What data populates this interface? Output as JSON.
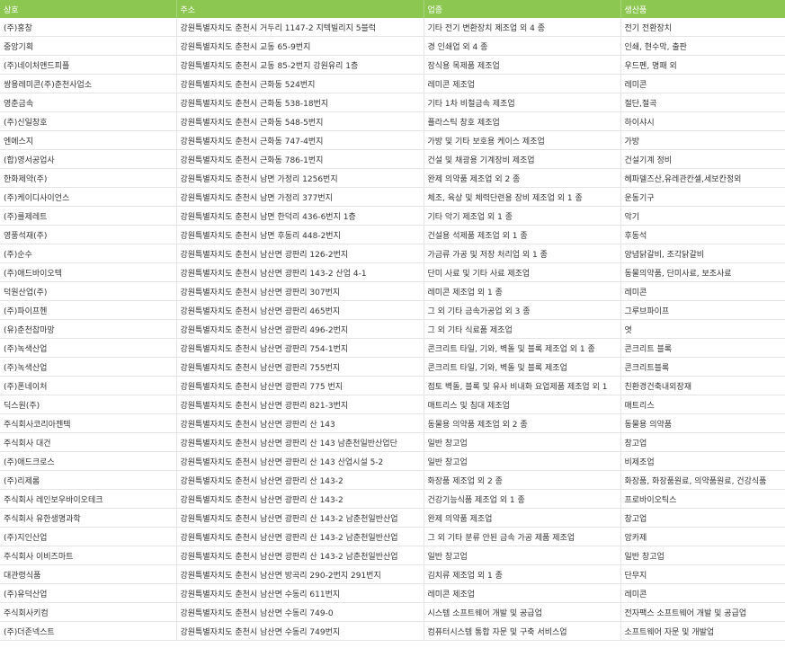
{
  "table": {
    "columns": [
      "상호",
      "주소",
      "업종",
      "생산품"
    ],
    "rows": [
      [
        "(주)홍창",
        "강원특별자치도 춘천시 거두리 1147-2 지텍빌리지 5블럭",
        "기타 전기 변환장치 제조업 외 4 종",
        "전기 전환장치"
      ],
      [
        "중앙기획",
        "강원특별자치도 춘천시 교동 65-9번지",
        "경 인쇄업 외 4 종",
        "인쇄, 현수막, 출판"
      ],
      [
        "(주)네이처앤드피플",
        "강원특별자치도 춘천시 교동 85-2번지 강원유리 1층",
        "장식용 목제품 제조업",
        "우드펜, 명패 외"
      ],
      [
        "쌍용레미콘(주)춘천사업소",
        "강원특별자치도 춘천시 근화동 524번지",
        "레미콘 제조업",
        "레미콘"
      ],
      [
        "영춘금속",
        "강원특별자치도 춘천시 근화동 538-18번지",
        "기타 1차 비철금속 제조업",
        "절단,절곡"
      ],
      [
        "(주)신일창호",
        "강원특별자치도 춘천시 근화동 548-5번지",
        "플라스틱 창호 제조업",
        "하이샤시"
      ],
      [
        "엔에스지",
        "강원특별자치도 춘천시 근화동 747-4번지",
        "가방 및 기타 보호용 케이스 제조업",
        "가방"
      ],
      [
        "(합)영서공업사",
        "강원특별자치도 춘천시 근화동 786-1번지",
        "건설 및 채광용 기계장비 제조업",
        "건설기계 정비"
      ],
      [
        "한화제약(주)",
        "강원특별자치도 춘천시 남면 가정리 1256번지",
        "완제 의약품 제조업 외 2 종",
        "헤파델즈산,유레관칸셀,세보칸정외"
      ],
      [
        "(주)케이디사이언스",
        "강원특별자치도 춘천시 남면 가정리 377번지",
        "체조, 육상 및 체력단련용 장비 제조업 외 1 종",
        "운동기구"
      ],
      [
        "(주)를제레트",
        "강원특별자치도 춘천시 남면 한덕리 436-6번지 1층",
        "기타 악기 제조업 외 1 종",
        "악기"
      ],
      [
        "영풍석재(주)",
        "강원특별자치도 춘천시 남면 후동리 448-2번지",
        "건설용 석제품 제조업 외 1 종",
        "후동석"
      ],
      [
        "(주)순수",
        "강원특별자치도 춘천시 남산면 광판리 126-2번지",
        "가금류 가공 및 저장 처리업 외 1 종",
        "양념닭갈비, 조각닭갈비"
      ],
      [
        "(주)애드바이오텍",
        "강원특별자치도 춘천시 남산면 광판리 143-2 산업 4-1",
        "단미 사료 및 기타 사료 제조업",
        "동물의약품, 단미사료, 보조사료"
      ],
      [
        "덕원산업(주)",
        "강원특별자치도 춘천시 남산면 광판리 307번지",
        "레미콘 제조업 외 1 종",
        "레미콘"
      ],
      [
        "(주)파이프헨",
        "강원특별자치도 춘천시 남산면 광판리 465번지",
        "그 외 기타 금속가공업 외 3 종",
        "그루브파이프"
      ],
      [
        "(유)춘천찹마망",
        "강원특별자치도 춘천시 남산면 광판리 496-2번지",
        "그 외 기타 식료품 제조업",
        "엿"
      ],
      [
        "(주)녹색산업",
        "강원특별자치도 춘천시 남산면 광판리 754-1번지",
        "콘크리트 타일, 기와, 벽돌 및 블록 제조업 외 1 종",
        "콘크리트 블록"
      ],
      [
        "(주)녹색산업",
        "강원특별자치도 춘천시 남산면 광판리 755번지",
        "콘크리트 타일, 기와, 벽돌 및 블록 제조업",
        "콘크리트블록"
      ],
      [
        "(주)폰네이처",
        "강원특별자치도 춘천시 남산면 광판리 775 번지",
        "점토 벽돌, 블록 및 유사 비내화 요업제품 제조업 외 1",
        "친환경건축내외장재"
      ],
      [
        "딕스원(주)",
        "강원특별자치도 춘천시 남산면 광판리 821-3번지",
        "매트리스 및 침대 제조업",
        "매트리스"
      ],
      [
        "주식회사코리아젠텍",
        "강원특별자치도 춘천시 남산면 광판리 산 143",
        "동물용 의약품 제조업 외 2 종",
        "동물용 의약품"
      ],
      [
        "주식회사 대건",
        "강원특별자치도 춘천시 남산면 광판리 산 143 남춘천일반산업단",
        "일반 창고업",
        "창고업"
      ],
      [
        "(주)애드크로스",
        "강원특별자치도 춘천시 남산면 광판리 산 143 산업시설 5-2",
        "일반 창고업",
        "비제조업"
      ],
      [
        "(주)리제롬",
        "강원특별자치도 춘천시 남산면 광판리 산 143-2",
        "화장품 제조업 외 2 종",
        "화장품, 화장품원료, 의약품원료, 건강식품"
      ],
      [
        "주식회사 레인보우바이오테크",
        "강원특별자치도 춘천시 남산면 광판리 산 143-2",
        "건강기능식품 제조업 외 1 종",
        "프로바이오틱스"
      ],
      [
        "주식회사 유한생명과학",
        "강원특별자치도 춘천시 남산면 광판리 산 143-2 남춘천일반산업",
        "완제 의약품 제조업",
        "창고업"
      ],
      [
        "(주)지인산업",
        "강원특별자치도 춘천시 남산면 광판리 산 143-2 남춘천일반산업",
        "그 외 기타 분류 안된 금속 가공 제품 제조업",
        "앙카제"
      ],
      [
        "주식회사 이비즈마트",
        "강원특별자치도 춘천시 남산면 광판리 산 143-2 남춘천일반산업",
        "일반 창고업",
        "일반 창고업"
      ],
      [
        "대관령식품",
        "강원특별자치도 춘천시 남산면 방곡리 290-2번지 291번지",
        "김치류 제조업 외 1 종",
        "단무지"
      ],
      [
        "(주)유덕산업",
        "강원특별자치도 춘천시 남산면 수동리 611번지",
        "레미콘 제조업",
        "레미콘"
      ],
      [
        "주식회사키컴",
        "강원특별자치도 춘천시 남산면 수동리 749-0",
        "시스템 소프트웨어 개발 및 공급업",
        "전자팩스 소프트웨어 개발 및 공급업"
      ],
      [
        "(주)더존넥스트",
        "강원특별자치도 춘천시 남산면 수동리 749번지",
        "컴퓨터시스템 통합 자문 및 구축 서비스업",
        "소프트웨어 자문 및 개발업"
      ]
    ]
  }
}
